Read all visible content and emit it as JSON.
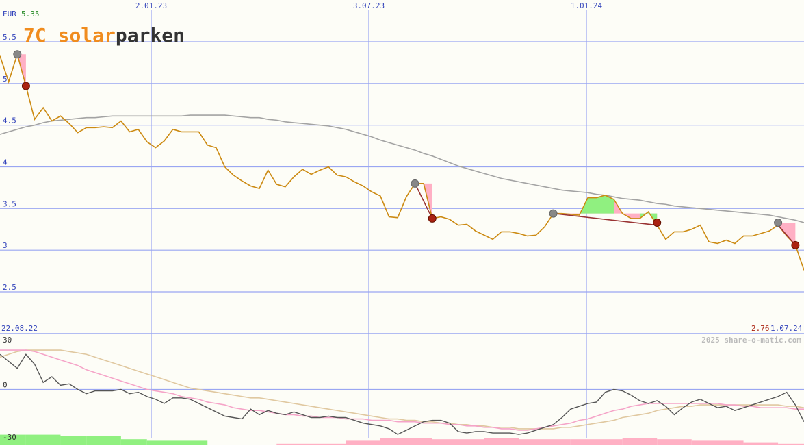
{
  "header": {
    "currency": "EUR",
    "last_value": "5.35",
    "logo": {
      "prefix": "7C ",
      "s": "s",
      "o": "o",
      "lar": "lar",
      "parken": "parken"
    }
  },
  "footer": {
    "start_date": "22.08.22",
    "end_value": "2.76",
    "end_date": "1.07.24",
    "copyright": "2025 share-o-matic.com"
  },
  "colors": {
    "background": "#fdfdf7",
    "grid": "#9aa6f2",
    "axis_text": "#3344bb",
    "price": "#cc8a12",
    "ma_long": "#a3a3a3",
    "logo_orange": "#f08c1e",
    "logo_dark": "#333333",
    "marker_high": "#888888",
    "marker_low": "#aa2211",
    "loss_fill": "#ffb0c4",
    "gain_fill": "#90f080",
    "trend_line": "#993333",
    "osc_main": "#555555",
    "osc_fast": "#f5a4c8",
    "osc_slow": "#e0c8a0",
    "hist_pos": "#90f080",
    "hist_neg": "#ffb0c4"
  },
  "chart_data": [
    {
      "type": "line",
      "title": "",
      "ylabel": "EUR",
      "ylim": [
        2.0,
        5.55
      ],
      "yticks": [
        2.5,
        3,
        3.5,
        4,
        4.5,
        5,
        5.5
      ],
      "ytick_labels": [
        "2.5",
        "3",
        "3.5",
        "4",
        "4.5",
        "5",
        "5.5"
      ],
      "xticks": [
        "2.01.23",
        "3.07.23",
        "1.01.24"
      ],
      "x_range": [
        "22.08.22",
        "1.07.24"
      ],
      "grid": true,
      "series": [
        {
          "role": "price",
          "values": [
            5.33,
            5.02,
            5.35,
            4.97,
            4.57,
            4.71,
            4.55,
            4.61,
            4.52,
            4.41,
            4.47,
            4.47,
            4.48,
            4.47,
            4.55,
            4.42,
            4.45,
            4.3,
            4.23,
            4.31,
            4.45,
            4.42,
            4.42,
            4.42,
            4.26,
            4.23,
            4.0,
            3.9,
            3.83,
            3.77,
            3.74,
            3.96,
            3.79,
            3.76,
            3.88,
            3.97,
            3.91,
            3.96,
            4.0,
            3.9,
            3.88,
            3.82,
            3.77,
            3.7,
            3.65,
            3.4,
            3.39,
            3.64,
            3.8,
            3.8,
            3.38,
            3.4,
            3.37,
            3.3,
            3.31,
            3.23,
            3.18,
            3.13,
            3.22,
            3.22,
            3.2,
            3.17,
            3.18,
            3.28,
            3.44,
            3.44,
            3.43,
            3.42,
            3.63,
            3.63,
            3.66,
            3.61,
            3.44,
            3.38,
            3.38,
            3.46,
            3.3,
            3.13,
            3.22,
            3.22,
            3.25,
            3.3,
            3.1,
            3.08,
            3.12,
            3.08,
            3.17,
            3.17,
            3.2,
            3.23,
            3.3,
            3.17,
            3.06,
            2.76
          ]
        },
        {
          "role": "moving-average",
          "values": [
            4.39,
            4.42,
            4.45,
            4.48,
            4.5,
            4.53,
            4.55,
            4.56,
            4.57,
            4.58,
            4.59,
            4.59,
            4.6,
            4.61,
            4.61,
            4.61,
            4.61,
            4.61,
            4.61,
            4.61,
            4.61,
            4.61,
            4.62,
            4.62,
            4.62,
            4.62,
            4.62,
            4.61,
            4.6,
            4.59,
            4.59,
            4.57,
            4.56,
            4.54,
            4.53,
            4.52,
            4.51,
            4.5,
            4.49,
            4.47,
            4.45,
            4.42,
            4.39,
            4.36,
            4.32,
            4.29,
            4.26,
            4.23,
            4.2,
            4.16,
            4.13,
            4.09,
            4.05,
            4.01,
            3.98,
            3.95,
            3.92,
            3.89,
            3.86,
            3.84,
            3.82,
            3.8,
            3.78,
            3.76,
            3.74,
            3.72,
            3.71,
            3.7,
            3.69,
            3.67,
            3.66,
            3.64,
            3.62,
            3.61,
            3.6,
            3.58,
            3.56,
            3.55,
            3.53,
            3.52,
            3.51,
            3.5,
            3.49,
            3.48,
            3.47,
            3.46,
            3.45,
            3.44,
            3.43,
            3.42,
            3.4,
            3.38,
            3.36,
            3.33
          ]
        }
      ],
      "markers": [
        {
          "kind": "high",
          "index": 2,
          "value": 5.35
        },
        {
          "kind": "low",
          "index": 3,
          "value": 4.97
        },
        {
          "kind": "high",
          "index": 48,
          "value": 3.8
        },
        {
          "kind": "low",
          "index": 50,
          "value": 3.38
        },
        {
          "kind": "high",
          "index": 64,
          "value": 3.44
        },
        {
          "kind": "low",
          "index": 76,
          "value": 3.33
        },
        {
          "kind": "high",
          "index": 90,
          "value": 3.33
        },
        {
          "kind": "low",
          "index": 92,
          "value": 3.06
        }
      ],
      "regions": [
        {
          "kind": "loss",
          "from": 2,
          "to": 3,
          "value": 5.35
        },
        {
          "kind": "loss",
          "from": 48,
          "to": 50,
          "value": 3.8
        },
        {
          "kind": "loss",
          "from": 64,
          "to": 76,
          "value": 3.44
        },
        {
          "kind": "gain",
          "from": 67,
          "to": 71,
          "value": 3.44
        },
        {
          "kind": "gain",
          "from": 74,
          "to": 76,
          "value": 3.44
        },
        {
          "kind": "loss",
          "from": 90,
          "to": 92,
          "value": 3.33
        }
      ],
      "trend_lines": [
        {
          "from": 48,
          "to": 50
        },
        {
          "from": 64,
          "to": 76
        },
        {
          "from": 90,
          "to": 92
        }
      ]
    },
    {
      "type": "line",
      "title": "",
      "ylim": [
        -30,
        30
      ],
      "yticks": [
        30,
        0,
        -30
      ],
      "ytick_labels": [
        "30",
        "0",
        "-30"
      ],
      "grid": true,
      "series": [
        {
          "role": "oscillator",
          "values": [
            25,
            20,
            15,
            25,
            18,
            5,
            9,
            3,
            4,
            0,
            -3,
            -1,
            -1,
            -1,
            0,
            -3,
            -2,
            -5,
            -7,
            -10,
            -6,
            -6,
            -7,
            -10,
            -13,
            -16,
            -19,
            -20,
            -21,
            -14,
            -18,
            -15,
            -17,
            -18,
            -16,
            -18,
            -20,
            -20,
            -19,
            -20,
            -20,
            -22,
            -24,
            -25,
            -26,
            -28,
            -32,
            -29,
            -26,
            -23,
            -22,
            -22,
            -24,
            -30,
            -31,
            -30,
            -30,
            -31,
            -31,
            -31,
            -32,
            -31,
            -29,
            -27,
            -25,
            -20,
            -14,
            -12,
            -10,
            -9,
            -2,
            0,
            -1,
            -4,
            -8,
            -10,
            -8,
            -12,
            -18,
            -13,
            -9,
            -7,
            -10,
            -13,
            -12,
            -15,
            -13,
            -11,
            -9,
            -7,
            -5,
            -2,
            -11,
            -23
          ]
        },
        {
          "role": "signal-fast",
          "values": [
            28,
            28,
            28,
            28,
            27,
            25,
            23,
            21,
            19,
            17,
            14,
            12,
            10,
            8,
            6,
            4,
            2,
            0,
            -1,
            -2,
            -3,
            -5,
            -6,
            -7,
            -9,
            -10,
            -11,
            -13,
            -14,
            -15,
            -15,
            -16,
            -17,
            -18,
            -18,
            -19,
            -19,
            -20,
            -20,
            -20,
            -21,
            -21,
            -21,
            -22,
            -22,
            -22,
            -23,
            -23,
            -23,
            -24,
            -24,
            -24,
            -25,
            -25,
            -26,
            -26,
            -27,
            -27,
            -28,
            -28,
            -29,
            -29,
            -28,
            -27,
            -26,
            -25,
            -24,
            -22,
            -21,
            -19,
            -17,
            -15,
            -14,
            -12,
            -11,
            -10,
            -10,
            -10,
            -10,
            -10,
            -10,
            -10,
            -10,
            -10,
            -11,
            -11,
            -12,
            -12,
            -13,
            -13,
            -13,
            -13,
            -14,
            -14
          ]
        },
        {
          "role": "signal-slow",
          "values": [
            23,
            25,
            27,
            28,
            28,
            28,
            28,
            28,
            27,
            26,
            25,
            23,
            21,
            19,
            17,
            15,
            13,
            11,
            9,
            7,
            5,
            3,
            1,
            0,
            -1,
            -2,
            -3,
            -4,
            -5,
            -6,
            -6,
            -7,
            -8,
            -9,
            -10,
            -11,
            -12,
            -13,
            -14,
            -15,
            -16,
            -17,
            -18,
            -19,
            -20,
            -21,
            -21,
            -22,
            -22,
            -23,
            -23,
            -24,
            -24,
            -25,
            -25,
            -26,
            -26,
            -27,
            -27,
            -27,
            -28,
            -28,
            -28,
            -28,
            -28,
            -27,
            -27,
            -26,
            -25,
            -24,
            -23,
            -22,
            -20,
            -19,
            -18,
            -17,
            -15,
            -14,
            -13,
            -12,
            -12,
            -11,
            -11,
            -11,
            -11,
            -11,
            -11,
            -11,
            -11,
            -11,
            -11,
            -12,
            -12,
            -13
          ]
        },
        {
          "role": "histogram",
          "values": [
            -10,
            -10,
            -10,
            -10,
            -10,
            -10,
            -10,
            -10,
            -10,
            -10,
            -10,
            -10,
            -10,
            -10,
            -10,
            -10,
            -10,
            -10,
            -10,
            -10,
            -10,
            -10,
            -10,
            -10,
            -10,
            -10,
            -10,
            -10,
            -10,
            -10,
            -10,
            -10,
            -10,
            -10,
            -10,
            -10,
            -10,
            -10,
            -10,
            -10,
            -10,
            -10,
            -10,
            -10,
            -10,
            -10,
            -10,
            -10,
            -10,
            -10,
            -10,
            -10,
            -10,
            -10,
            -10,
            -10,
            -10,
            -10,
            -10,
            -10,
            -10,
            -10,
            -10,
            -10,
            -10,
            -10,
            -10,
            -10,
            -10,
            -10,
            -10,
            -10,
            -10,
            -10,
            -10,
            -10,
            -10,
            -10,
            -10,
            -10,
            -10,
            -10,
            -10,
            -10,
            -10,
            -10,
            -10,
            -10,
            -10,
            -10,
            -10,
            -10,
            -10,
            -10
          ],
          "bars": [
            {
              "x0": 0,
              "x1": 3,
              "v": 7
            },
            {
              "x0": 3,
              "x1": 7,
              "v": 7
            },
            {
              "x0": 7,
              "x1": 10,
              "v": 6
            },
            {
              "x0": 10,
              "x1": 14,
              "v": 6
            },
            {
              "x0": 14,
              "x1": 17,
              "v": 4
            },
            {
              "x0": 17,
              "x1": 24,
              "v": 3
            },
            {
              "x0": 32,
              "x1": 40,
              "v": -1
            },
            {
              "x0": 40,
              "x1": 44,
              "v": -3
            },
            {
              "x0": 44,
              "x1": 50,
              "v": -5
            },
            {
              "x0": 50,
              "x1": 56,
              "v": -4
            },
            {
              "x0": 56,
              "x1": 60,
              "v": -5
            },
            {
              "x0": 60,
              "x1": 66,
              "v": -4
            },
            {
              "x0": 66,
              "x1": 72,
              "v": -4
            },
            {
              "x0": 72,
              "x1": 76,
              "v": -5
            },
            {
              "x0": 76,
              "x1": 80,
              "v": -4
            },
            {
              "x0": 80,
              "x1": 86,
              "v": -3
            },
            {
              "x0": 86,
              "x1": 90,
              "v": -2
            },
            {
              "x0": 90,
              "x1": 94,
              "v": -1
            }
          ]
        }
      ]
    }
  ]
}
